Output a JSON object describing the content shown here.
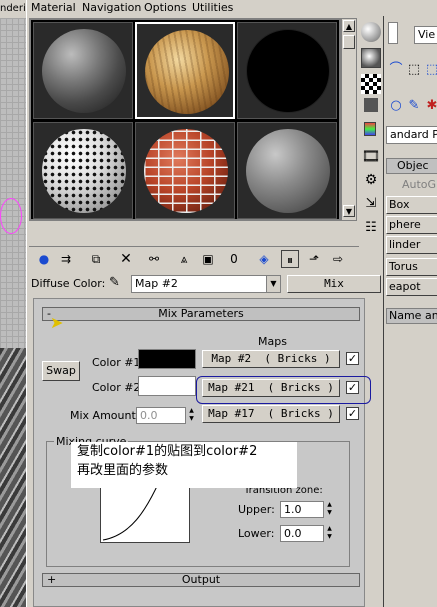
{
  "background_left": {
    "title_fragment": "nderi"
  },
  "menubar": {
    "items": [
      "Material",
      "Navigation",
      "Options",
      "Utilities"
    ]
  },
  "sample_slots": [
    {
      "name": "gray-cloudy-sphere",
      "color": "#6e6e6e"
    },
    {
      "name": "wood-sphere",
      "color": "#b8894a"
    },
    {
      "name": "black-sphere",
      "color": "#000000"
    },
    {
      "name": "dotted-sphere",
      "color": "#e8e8e8"
    },
    {
      "name": "bricks-sphere",
      "color": "#c04a2e"
    },
    {
      "name": "plain-gray-sphere",
      "color": "#8a8a8a"
    }
  ],
  "diffuse": {
    "label": "Diffuse Color:",
    "map_name": "Map #2",
    "type_button": "Mix"
  },
  "mix_parameters": {
    "header_minus": "-",
    "header": "Mix Parameters",
    "maps_label": "Maps",
    "swap_label": "Swap",
    "color1_label": "Color #1",
    "color2_label": "Color #2",
    "color1_value": "#000000",
    "color2_value": "#ffffff",
    "map1": "Map #2  ( Bricks )",
    "map2": "Map #21  ( Bricks )",
    "map3": "Map #17  ( Bricks )",
    "map1_checked": "✓",
    "map2_checked": "✓",
    "map3_checked": "✓",
    "mix_amount_label": "Mix Amount:",
    "mix_amount_value": "0.0",
    "mixing_curve_label": "Mixing curve",
    "transition_zone_label": "Transition zone:",
    "upper_label": "Upper:",
    "upper_value": "1.0",
    "lower_label": "Lower:",
    "lower_value": "0.0"
  },
  "annotation": {
    "line1": "复制color#1的贴图到color#2",
    "line2": "再改里面的参数"
  },
  "output_rollout": {
    "header_plus": "+",
    "header": "Output"
  },
  "right_panel": {
    "view_combo": "Vie",
    "standard_combo": "andard P",
    "object_type_header": "Objec",
    "autogrid": "AutoG",
    "buttons": [
      "Box",
      "phere",
      "linder",
      "Torus",
      "eapot"
    ],
    "name_header": "Name an"
  },
  "highlight_color": "#1a1aa0"
}
